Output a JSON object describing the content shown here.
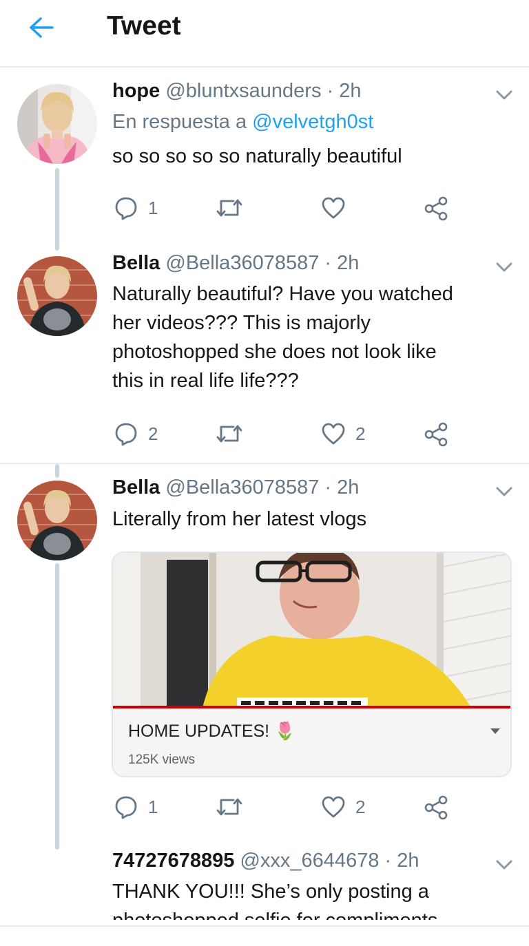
{
  "header": {
    "title": "Tweet"
  },
  "colors": {
    "accent": "#1da1f2",
    "text": "#14171a",
    "muted": "#657786",
    "thread_line": "#ccd6dd"
  },
  "tweets": [
    {
      "name": "hope",
      "handle": "@bluntxsaunders",
      "time": "· 2h",
      "reply_prefix": "En respuesta a",
      "reply_mention": "@velvetgh0st",
      "text": "so so so so so naturally beautiful",
      "actions": {
        "reply_count": "1",
        "retweet_count": "",
        "like_count": ""
      }
    },
    {
      "name": "Bella",
      "handle": "@Bella36078587",
      "time": "· 2h",
      "text_lines": [
        "Naturally beautiful? Have you watched",
        "her videos??? This is majorly",
        "photoshopped she does not look like",
        "this in real life life???"
      ],
      "actions": {
        "reply_count": "2",
        "retweet_count": "",
        "like_count": "2"
      }
    },
    {
      "name": "Bella",
      "handle": "@Bella36078587",
      "time": "· 2h",
      "text": "Literally from her latest vlogs",
      "card": {
        "title": "HOME UPDATES!",
        "emoji": "🌷",
        "views": "125K views"
      },
      "actions": {
        "reply_count": "1",
        "retweet_count": "",
        "like_count": "2"
      }
    },
    {
      "name": "74727678895",
      "handle": "@xxx_6644678",
      "time": "· 2h",
      "text_lines": [
        "THANK YOU!!! She’s only posting a",
        "photoshopped selfie for compliments"
      ]
    }
  ]
}
